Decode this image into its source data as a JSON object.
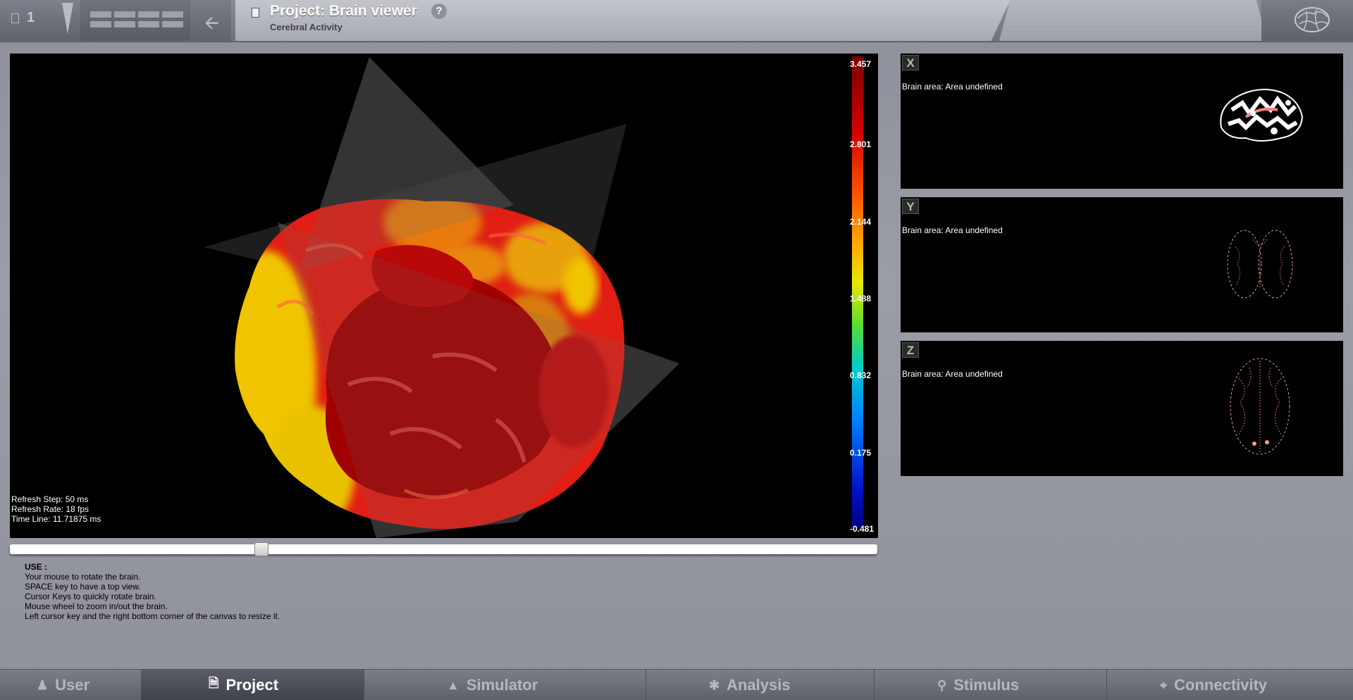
{
  "header": {
    "count": "1",
    "project_title": "Project: Brain viewer",
    "subtitle": "Cerebral Activity",
    "help": "?",
    "icons": [
      "document-icon",
      "dropdown-triangle-icon",
      "grid-view-icon",
      "back-arrow-icon",
      "help-icon",
      "brain-logo-icon"
    ]
  },
  "viewer": {
    "stats": {
      "refresh_step": "Refresh Step: 50 ms",
      "refresh_rate": "Refresh Rate: 18 fps",
      "time_line": "Time Line: 11.71875 ms"
    },
    "colorbar_labels": [
      "3.457",
      "2.801",
      "2.144",
      "1.488",
      "0.832",
      "0.175",
      "-0.481"
    ],
    "colors": {
      "high": "#8b0000",
      "mid_high": "#ff4500",
      "mid": "#e8e800",
      "low": "#000080"
    }
  },
  "timeline": {
    "position": 0.29
  },
  "usage": {
    "header": "USE :",
    "lines": [
      "Your mouse to rotate the brain.",
      "SPACE key to have a top view.",
      "Cursor Keys to quickly rotate brain.",
      "Mouse wheel to zoom in/out the brain.",
      "Left cursor key and the right bottom corner of the canvas to resize it."
    ]
  },
  "slices": [
    {
      "axis": "X",
      "text": "Brain area: Area undefined"
    },
    {
      "axis": "Y",
      "text": "Brain area: Area undefined"
    },
    {
      "axis": "Z",
      "text": "Brain area: Area undefined"
    }
  ],
  "nav": {
    "tabs": [
      {
        "label": "User",
        "icon": "user-icon",
        "active": false
      },
      {
        "label": "Project",
        "icon": "document-icon",
        "active": true
      },
      {
        "label": "Simulator",
        "icon": "rocket-icon",
        "active": false
      },
      {
        "label": "Analysis",
        "icon": "gear-icon",
        "active": false
      },
      {
        "label": "Stimulus",
        "icon": "pin-icon",
        "active": false
      },
      {
        "label": "Connectivity",
        "icon": "network-icon",
        "active": false
      }
    ]
  }
}
